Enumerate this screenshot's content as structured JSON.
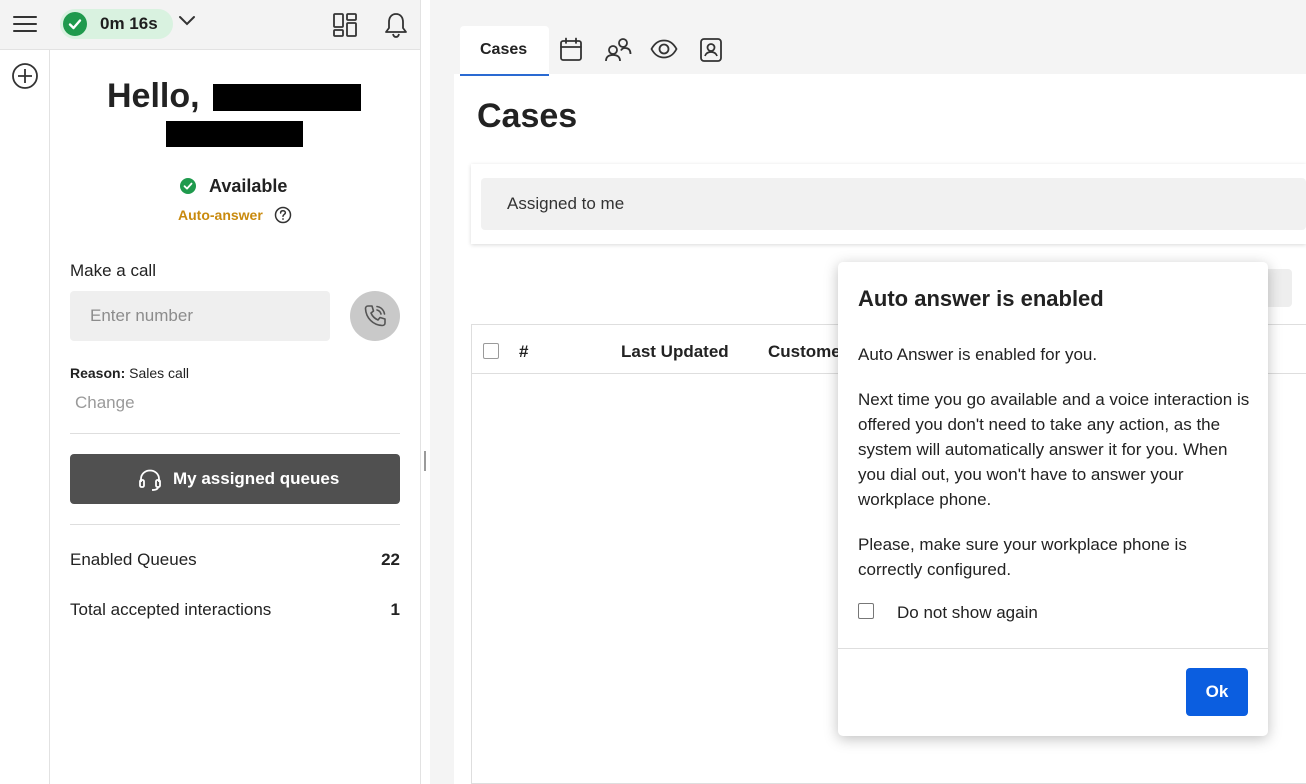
{
  "topbar": {
    "timer": "0m 16s"
  },
  "profile": {
    "greeting": "Hello,",
    "status": "Available",
    "auto_answer_label": "Auto-answer",
    "make_call_label": "Make a call",
    "number_placeholder": "Enter number",
    "reason_label": "Reason:",
    "reason_value": "Sales call",
    "change_label": "Change",
    "queues_button_label": "My assigned queues",
    "stats": [
      {
        "label": "Enabled Queues",
        "value": "22"
      },
      {
        "label": "Total accepted interactions",
        "value": "1"
      }
    ]
  },
  "main": {
    "tabs": [
      {
        "label": "Cases",
        "active": true
      },
      {
        "icon": "calendar-icon"
      },
      {
        "icon": "people-icon"
      },
      {
        "icon": "eye-icon"
      },
      {
        "icon": "contact-card-icon"
      }
    ],
    "page_title": "Cases",
    "filter_value": "Assigned to me",
    "table_headers": [
      "#",
      "Last Updated",
      "Custome"
    ]
  },
  "modal": {
    "title": "Auto answer is enabled",
    "paragraphs": [
      "Auto Answer is enabled for you.",
      "Next time you go available and a voice interaction is offered you don't need to take any action, as the system will automatically answer it for you. When you dial out, you won't have to answer your workplace phone.",
      "Please, make sure your workplace phone is correctly configured."
    ],
    "do_not_show_label": "Do not show again",
    "ok_label": "Ok"
  },
  "colors": {
    "available_green": "#1f9a4d",
    "auto_answer_amber": "#c98a0e",
    "primary_blue": "#0b5ee0",
    "tab_underline": "#2a6ad2",
    "queues_button": "#505050"
  }
}
